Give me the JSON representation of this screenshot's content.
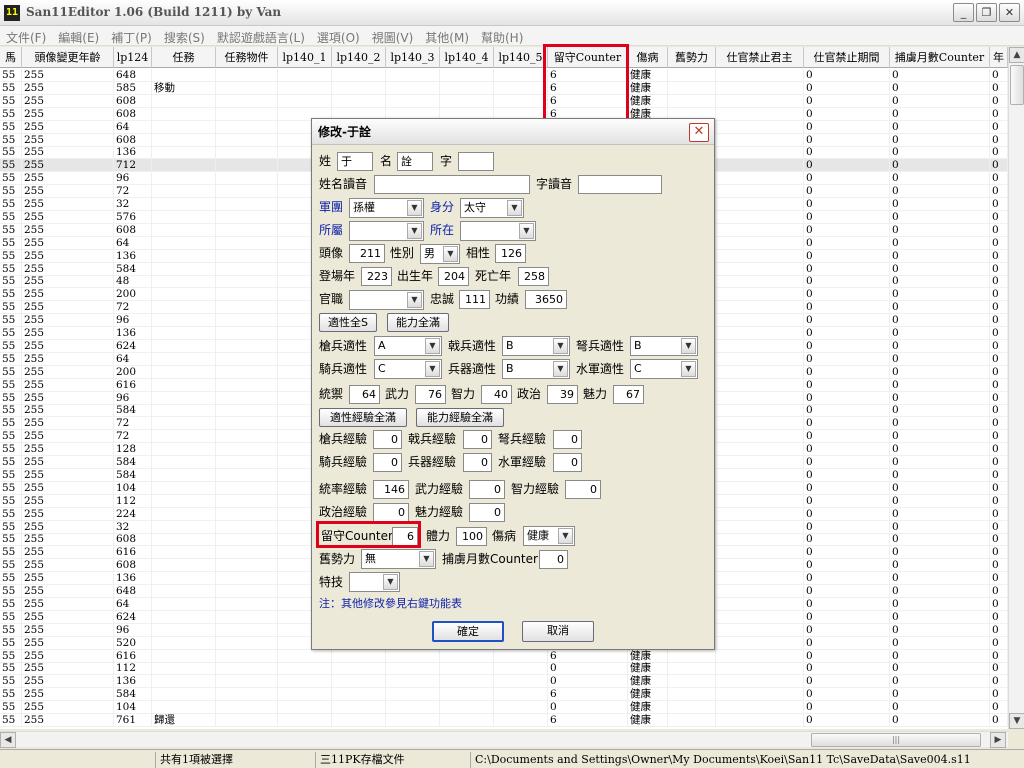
{
  "window": {
    "title": "San11Editor 1.06 (Build 1211) by Van",
    "icon_text": "11",
    "minimize": "_",
    "maximize": "❐",
    "close": "✕"
  },
  "menu": [
    "文件(F)",
    "編輯(E)",
    "補丁(P)",
    "搜索(S)",
    "默認遊戲語言(L)",
    "選項(O)",
    "視圖(V)",
    "其他(M)",
    "幫助(H)"
  ],
  "grid": {
    "columns": [
      "馬",
      "頭像變更年齡",
      "lp124",
      "任務",
      "任務物件",
      "lp140_1",
      "lp140_2",
      "lp140_3",
      "lp140_4",
      "lp140_5",
      "留守Counter",
      "傷病",
      "舊勢力",
      "仕官禁止君主",
      "仕官禁止期間",
      "捕虜月數Counter",
      "年"
    ],
    "rows": [
      [
        "55",
        "255",
        "648",
        "",
        "",
        "",
        "",
        "",
        "",
        "",
        "6",
        "健康",
        "",
        "",
        "0",
        "0",
        "0"
      ],
      [
        "55",
        "255",
        "585",
        "移動",
        "",
        "",
        "",
        "",
        "",
        "",
        "6",
        "健康",
        "",
        "",
        "0",
        "0",
        "0"
      ],
      [
        "55",
        "255",
        "608",
        "",
        "",
        "",
        "",
        "",
        "",
        "",
        "6",
        "健康",
        "",
        "",
        "0",
        "0",
        "0"
      ],
      [
        "55",
        "255",
        "608",
        "",
        "",
        "",
        "",
        "",
        "",
        "",
        "6",
        "健康",
        "",
        "",
        "0",
        "0",
        "0"
      ],
      [
        "55",
        "255",
        "64",
        "",
        "",
        "",
        "",
        "",
        "",
        "",
        "",
        "",
        "",
        "",
        "0",
        "0",
        "0"
      ],
      [
        "55",
        "255",
        "608",
        "",
        "",
        "",
        "",
        "",
        "",
        "",
        "",
        "",
        "",
        "",
        "0",
        "0",
        "0"
      ],
      [
        "55",
        "255",
        "136",
        "",
        "",
        "",
        "",
        "",
        "",
        "",
        "",
        "",
        "",
        "",
        "0",
        "0",
        "0"
      ],
      [
        "55",
        "255",
        "712",
        "",
        "",
        "",
        "",
        "",
        "",
        "",
        "",
        "",
        "",
        "",
        "0",
        "0",
        "0"
      ],
      [
        "55",
        "255",
        "96",
        "",
        "",
        "",
        "",
        "",
        "",
        "",
        "",
        "",
        "",
        "",
        "0",
        "0",
        "0"
      ],
      [
        "55",
        "255",
        "72",
        "",
        "",
        "",
        "",
        "",
        "",
        "",
        "",
        "",
        "",
        "",
        "0",
        "0",
        "0"
      ],
      [
        "55",
        "255",
        "32",
        "",
        "",
        "",
        "",
        "",
        "",
        "",
        "",
        "",
        "",
        "",
        "0",
        "0",
        "0"
      ],
      [
        "55",
        "255",
        "576",
        "",
        "",
        "",
        "",
        "",
        "",
        "",
        "",
        "",
        "",
        "",
        "0",
        "0",
        "0"
      ],
      [
        "55",
        "255",
        "608",
        "",
        "",
        "",
        "",
        "",
        "",
        "",
        "",
        "",
        "",
        "",
        "0",
        "0",
        "0"
      ],
      [
        "55",
        "255",
        "64",
        "",
        "",
        "",
        "",
        "",
        "",
        "",
        "",
        "",
        "",
        "",
        "0",
        "0",
        "0"
      ],
      [
        "55",
        "255",
        "136",
        "",
        "",
        "",
        "",
        "",
        "",
        "",
        "",
        "",
        "",
        "",
        "0",
        "0",
        "0"
      ],
      [
        "55",
        "255",
        "584",
        "",
        "",
        "",
        "",
        "",
        "",
        "",
        "",
        "",
        "",
        "",
        "0",
        "0",
        "0"
      ],
      [
        "55",
        "255",
        "48",
        "",
        "",
        "",
        "",
        "",
        "",
        "",
        "",
        "",
        "",
        "",
        "0",
        "0",
        "0"
      ],
      [
        "55",
        "255",
        "200",
        "",
        "",
        "",
        "",
        "",
        "",
        "",
        "",
        "",
        "",
        "",
        "0",
        "0",
        "0"
      ],
      [
        "55",
        "255",
        "72",
        "",
        "",
        "",
        "",
        "",
        "",
        "",
        "",
        "",
        "",
        "",
        "0",
        "0",
        "0"
      ],
      [
        "55",
        "255",
        "96",
        "",
        "",
        "",
        "",
        "",
        "",
        "",
        "",
        "",
        "",
        "",
        "0",
        "0",
        "0"
      ],
      [
        "55",
        "255",
        "136",
        "",
        "",
        "",
        "",
        "",
        "",
        "",
        "",
        "",
        "",
        "",
        "0",
        "0",
        "0"
      ],
      [
        "55",
        "255",
        "624",
        "",
        "",
        "",
        "",
        "",
        "",
        "",
        "",
        "",
        "",
        "",
        "0",
        "0",
        "0"
      ],
      [
        "55",
        "255",
        "64",
        "",
        "",
        "",
        "",
        "",
        "",
        "",
        "",
        "",
        "",
        "",
        "0",
        "0",
        "0"
      ],
      [
        "55",
        "255",
        "200",
        "",
        "",
        "",
        "",
        "",
        "",
        "",
        "",
        "",
        "",
        "",
        "0",
        "0",
        "0"
      ],
      [
        "55",
        "255",
        "616",
        "",
        "",
        "",
        "",
        "",
        "",
        "",
        "",
        "",
        "",
        "",
        "0",
        "0",
        "0"
      ],
      [
        "55",
        "255",
        "96",
        "",
        "",
        "",
        "",
        "",
        "",
        "",
        "",
        "",
        "",
        "",
        "0",
        "0",
        "0"
      ],
      [
        "55",
        "255",
        "584",
        "",
        "",
        "",
        "",
        "",
        "",
        "",
        "",
        "",
        "",
        "",
        "0",
        "0",
        "0"
      ],
      [
        "55",
        "255",
        "72",
        "",
        "",
        "",
        "",
        "",
        "",
        "",
        "",
        "",
        "",
        "",
        "0",
        "0",
        "0"
      ],
      [
        "55",
        "255",
        "72",
        "",
        "",
        "",
        "",
        "",
        "",
        "",
        "",
        "",
        "",
        "",
        "0",
        "0",
        "0"
      ],
      [
        "55",
        "255",
        "128",
        "",
        "",
        "",
        "",
        "",
        "",
        "",
        "",
        "",
        "",
        "",
        "0",
        "0",
        "0"
      ],
      [
        "55",
        "255",
        "584",
        "",
        "",
        "",
        "",
        "",
        "",
        "",
        "",
        "",
        "",
        "",
        "0",
        "0",
        "0"
      ],
      [
        "55",
        "255",
        "584",
        "",
        "",
        "",
        "",
        "",
        "",
        "",
        "",
        "",
        "",
        "",
        "0",
        "0",
        "0"
      ],
      [
        "55",
        "255",
        "104",
        "",
        "",
        "",
        "",
        "",
        "",
        "",
        "",
        "",
        "",
        "",
        "0",
        "0",
        "0"
      ],
      [
        "55",
        "255",
        "112",
        "",
        "",
        "",
        "",
        "",
        "",
        "",
        "",
        "",
        "",
        "",
        "0",
        "0",
        "0"
      ],
      [
        "55",
        "255",
        "224",
        "",
        "",
        "",
        "",
        "",
        "",
        "",
        "",
        "",
        "",
        "",
        "0",
        "0",
        "0"
      ],
      [
        "55",
        "255",
        "32",
        "",
        "",
        "",
        "",
        "",
        "",
        "",
        "",
        "",
        "",
        "",
        "0",
        "0",
        "0"
      ],
      [
        "55",
        "255",
        "608",
        "",
        "",
        "",
        "",
        "",
        "",
        "",
        "",
        "",
        "",
        "",
        "0",
        "0",
        "0"
      ],
      [
        "55",
        "255",
        "616",
        "",
        "",
        "",
        "",
        "",
        "",
        "",
        "",
        "",
        "",
        "",
        "0",
        "0",
        "0"
      ],
      [
        "55",
        "255",
        "608",
        "",
        "",
        "",
        "",
        "",
        "",
        "",
        "",
        "",
        "",
        "",
        "0",
        "0",
        "0"
      ],
      [
        "55",
        "255",
        "136",
        "",
        "",
        "",
        "",
        "",
        "",
        "",
        "",
        "",
        "",
        "",
        "0",
        "0",
        "0"
      ],
      [
        "55",
        "255",
        "648",
        "",
        "",
        "",
        "",
        "",
        "",
        "",
        "",
        "",
        "",
        "",
        "0",
        "0",
        "0"
      ],
      [
        "55",
        "255",
        "64",
        "",
        "",
        "",
        "",
        "",
        "",
        "",
        "",
        "",
        "",
        "",
        "0",
        "0",
        "0"
      ],
      [
        "55",
        "255",
        "624",
        "",
        "",
        "",
        "",
        "",
        "",
        "",
        "",
        "",
        "",
        "",
        "0",
        "0",
        "0"
      ],
      [
        "55",
        "255",
        "96",
        "",
        "",
        "",
        "",
        "",
        "",
        "",
        "",
        "",
        "",
        "",
        "0",
        "0",
        "0"
      ],
      [
        "55",
        "255",
        "520",
        "",
        "",
        "",
        "",
        "",
        "",
        "",
        "",
        "",
        "",
        "",
        "0",
        "0",
        "0"
      ],
      [
        "55",
        "255",
        "616",
        "",
        "",
        "",
        "",
        "",
        "",
        "",
        "6",
        "健康",
        "",
        "",
        "0",
        "0",
        "0"
      ],
      [
        "55",
        "255",
        "112",
        "",
        "",
        "",
        "",
        "",
        "",
        "",
        "0",
        "健康",
        "",
        "",
        "0",
        "0",
        "0"
      ],
      [
        "55",
        "255",
        "136",
        "",
        "",
        "",
        "",
        "",
        "",
        "",
        "0",
        "健康",
        "",
        "",
        "0",
        "0",
        "0"
      ],
      [
        "55",
        "255",
        "584",
        "",
        "",
        "",
        "",
        "",
        "",
        "",
        "6",
        "健康",
        "",
        "",
        "0",
        "0",
        "0"
      ],
      [
        "55",
        "255",
        "104",
        "",
        "",
        "",
        "",
        "",
        "",
        "",
        "0",
        "健康",
        "",
        "",
        "0",
        "0",
        "0"
      ],
      [
        "55",
        "255",
        "761",
        "歸還",
        "",
        "",
        "",
        "",
        "",
        "",
        "6",
        "健康",
        "",
        "",
        "0",
        "0",
        "0"
      ]
    ]
  },
  "status": {
    "selection": "共有1項被選擇",
    "filetype": "三11PK存檔文件",
    "path": "C:\\Documents and Settings\\Owner\\My Documents\\Koei\\San11 Tc\\SaveData\\Save004.s11"
  },
  "scroll": {
    "up": "▲",
    "down": "▼",
    "left": "◀",
    "right": "▶",
    "grip": "|||"
  },
  "dialog": {
    "title": "修改-于詮",
    "close": "✕",
    "surname_label": "姓",
    "surname": "于",
    "given_label": "名",
    "given": "詮",
    "style_label": "字",
    "style": "",
    "name_reading_label": "姓名讀音",
    "name_reading": "",
    "style_reading_label": "字讀音",
    "style_reading": "",
    "army_label": "軍團",
    "army": "孫權",
    "status_label": "身分",
    "status": "太守",
    "belong_label": "所屬",
    "belong": "",
    "location_label": "所在",
    "location": "",
    "portrait_label": "頭像",
    "portrait": "211",
    "gender_label": "性別",
    "gender": "男",
    "affinity_label": "相性",
    "affinity": "126",
    "appear_label": "登場年",
    "appear": "223",
    "birth_label": "出生年",
    "birth": "204",
    "death_label": "死亡年",
    "death": "258",
    "rank_label": "官職",
    "rank": "",
    "loyalty_label": "忠誠",
    "loyalty": "111",
    "merit_label": "功績",
    "merit": "3650",
    "btn_apt_all": "適性全S",
    "btn_stat_all": "能力全滿",
    "spear_label": "槍兵適性",
    "spear": "A",
    "halberd_label": "戟兵適性",
    "halberd": "B",
    "bow_label": "弩兵適性",
    "bow": "B",
    "cavalry_label": "騎兵適性",
    "cavalry": "C",
    "siege_label": "兵器適性",
    "siege": "B",
    "navy_label": "水軍適性",
    "navy": "C",
    "lead_label": "統禦",
    "lead": "64",
    "war_label": "武力",
    "war": "76",
    "int_label": "智力",
    "int": "40",
    "pol_label": "政治",
    "pol": "39",
    "chr_label": "魅力",
    "chr": "67",
    "btn_apt_exp_all": "適性經驗全滿",
    "btn_stat_exp_all": "能力經驗全滿",
    "spear_exp_label": "槍兵經驗",
    "spear_exp": "0",
    "halberd_exp_label": "戟兵經驗",
    "halberd_exp": "0",
    "bow_exp_label": "弩兵經驗",
    "bow_exp": "0",
    "cavalry_exp_label": "騎兵經驗",
    "cavalry_exp": "0",
    "siege_exp_label": "兵器經驗",
    "siege_exp": "0",
    "navy_exp_label": "水軍經驗",
    "navy_exp": "0",
    "lead_exp_label": "統率經驗",
    "lead_exp": "146",
    "war_exp_label": "武力經驗",
    "war_exp": "0",
    "int_exp_label": "智力經驗",
    "int_exp": "0",
    "pol_exp_label": "政治經驗",
    "pol_exp": "0",
    "chr_exp_label": "魅力經驗",
    "chr_exp": "0",
    "guard_label": "留守Counter",
    "guard": "6",
    "hp_label": "體力",
    "hp": "100",
    "injury_label": "傷病",
    "injury": "健康",
    "old_force_label": "舊勢力",
    "old_force": "無",
    "captive_label": "捕虜月數Counter",
    "captive": "0",
    "skill_label": "特技",
    "skill": "",
    "note": "注：其他修改參見右鍵功能表",
    "ok": "確定",
    "cancel": "取消"
  },
  "arrow_glyph": "▼"
}
